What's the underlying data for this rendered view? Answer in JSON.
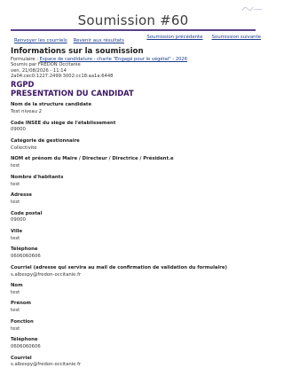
{
  "page": {
    "title": "Soumission #60",
    "nav": {
      "previous_label": "Soumission précédente",
      "next_label": "Soumission suivante"
    },
    "actions": {
      "back_mails_label": "Renvoyer les courriels",
      "back_results_label": "Revenir aux résultats"
    }
  },
  "info": {
    "heading": "Informations sur la soumission",
    "form_prefix": "Formulaire : ",
    "form_link": "Espace de candidature - charte \"Engagé pour le végétal\" - 2026",
    "submitted_by": "Soumis par FREDON Occitanie",
    "date": "ven, 21/08/2026 - 11:14",
    "ip": "2a04:cec0:1227:2499:3002:cc18:aa1a:6448"
  },
  "section": {
    "code": "RGPD",
    "title": "PRESENTATION DU CANDIDAT"
  },
  "fields": [
    {
      "label": "Nom de la structure candidate",
      "value": "Test niveau 2"
    },
    {
      "label": "Code INSEE du siège de l'établissement",
      "value": "09000"
    },
    {
      "label": "Catégorie de gestionnaire",
      "value": "Collectivité"
    },
    {
      "label": "NOM et prénom du Maire / Directeur / Directrice / Président.e",
      "value": "test"
    },
    {
      "label": "Nombre d'habitants",
      "value": "test"
    },
    {
      "label": "Adresse",
      "value": "test"
    },
    {
      "label": "Code postal",
      "value": "09000"
    },
    {
      "label": "Ville",
      "value": "test"
    },
    {
      "label": "Téléphone",
      "value": "0606060606"
    },
    {
      "label": "Courriel (adresse qui servira au mail de confirmation de validation du formulaire)",
      "value": "s.albespy@fredon-occitanie.fr"
    },
    {
      "label": "Nom",
      "value": "test"
    },
    {
      "label": "Prénom",
      "value": "test"
    },
    {
      "label": "Fonction",
      "value": "test"
    },
    {
      "label": "Téléphone",
      "value": "0606060606"
    },
    {
      "label": "Courriel",
      "value": "s.albespy@fredon-occitanie.fr"
    }
  ],
  "colors": {
    "accent": "#5b3f8c",
    "section": "#3d1566",
    "link": "#1b3c8c"
  }
}
